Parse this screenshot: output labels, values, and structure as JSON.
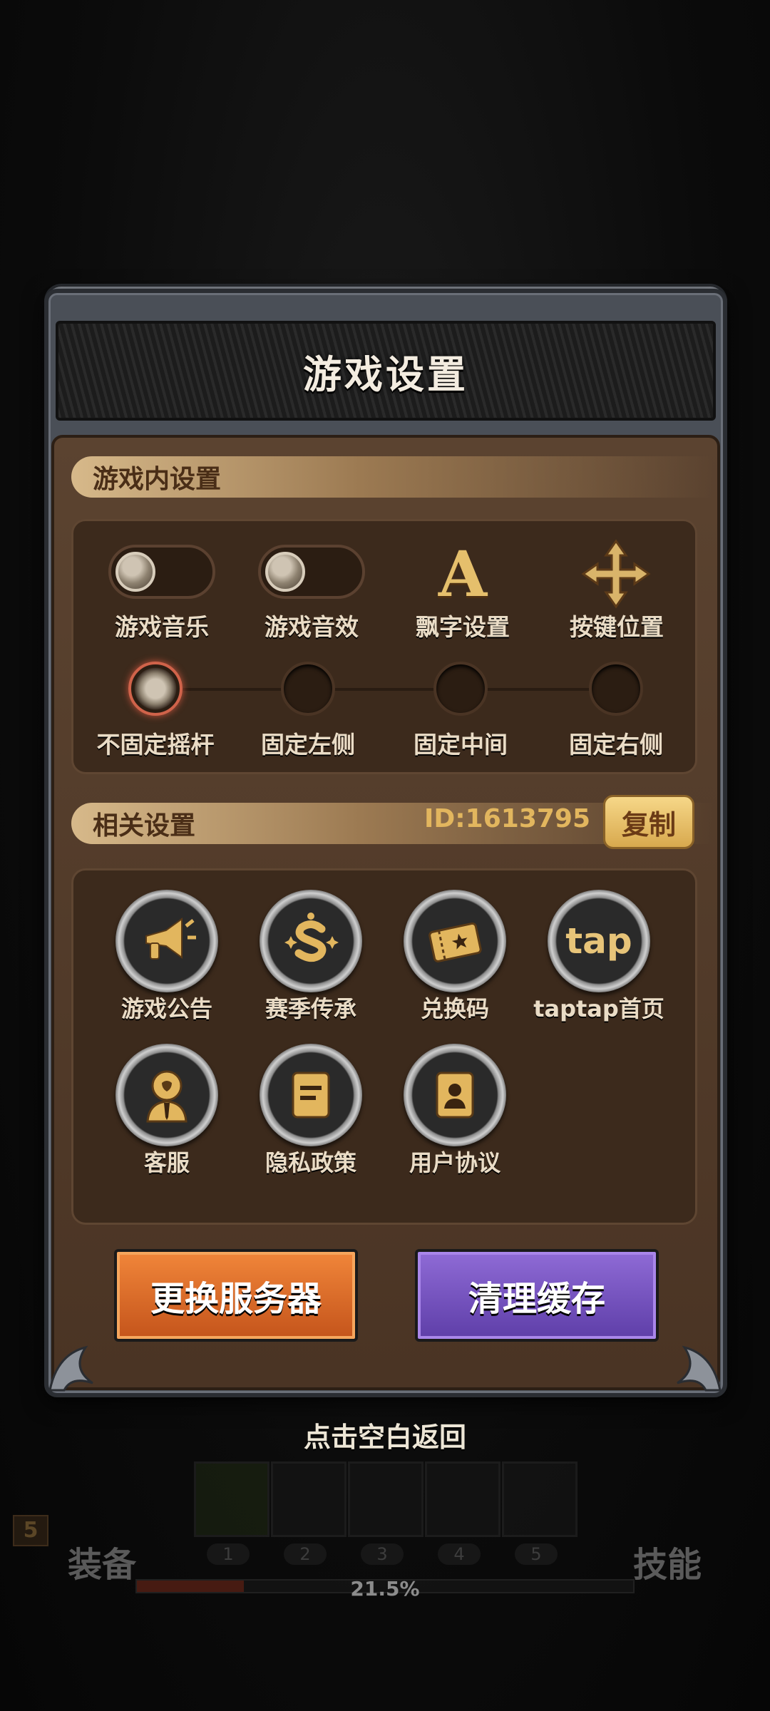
{
  "dialog": {
    "title": "游戏设置"
  },
  "in_game": {
    "header": "游戏内设置",
    "toggles": [
      {
        "label": "游戏音乐",
        "state": "off"
      },
      {
        "label": "游戏音效",
        "state": "off"
      }
    ],
    "font_setting_label": "飘字设置",
    "font_icon_glyph": "A",
    "key_position_label": "按键位置",
    "joystick_options": [
      {
        "label": "不固定摇杆",
        "selected": true
      },
      {
        "label": "固定左侧",
        "selected": false
      },
      {
        "label": "固定中间",
        "selected": false
      },
      {
        "label": "固定右侧",
        "selected": false
      }
    ]
  },
  "related": {
    "header": "相关设置",
    "id_text": "ID:1613795",
    "copy_label": "复制",
    "items": [
      {
        "label": "游戏公告",
        "icon": "megaphone-icon"
      },
      {
        "label": "赛季传承",
        "icon": "season-s-icon"
      },
      {
        "label": "兑换码",
        "icon": "ticket-icon"
      },
      {
        "label": "taptap首页",
        "icon": "taptap-icon",
        "glyph": "tap"
      },
      {
        "label": "客服",
        "icon": "customer-service-icon"
      },
      {
        "label": "隐私政策",
        "icon": "document-icon"
      },
      {
        "label": "用户协议",
        "icon": "user-agreement-icon"
      }
    ]
  },
  "actions": {
    "change_server": "更换服务器",
    "clear_cache": "清理缓存"
  },
  "back_hint": "点击空白返回",
  "hud": {
    "equip_label": "装备",
    "skill_label": "技能",
    "level": "5",
    "slot_numbers": [
      "1",
      "2",
      "3",
      "4",
      "5"
    ],
    "progress_text": "21.5%",
    "progress_value": 0.215
  },
  "colors": {
    "accent_gold": "#e2b65e",
    "orange_button": "#e0702c",
    "purple_button": "#7554c0",
    "selected_ring": "#d0634a"
  }
}
